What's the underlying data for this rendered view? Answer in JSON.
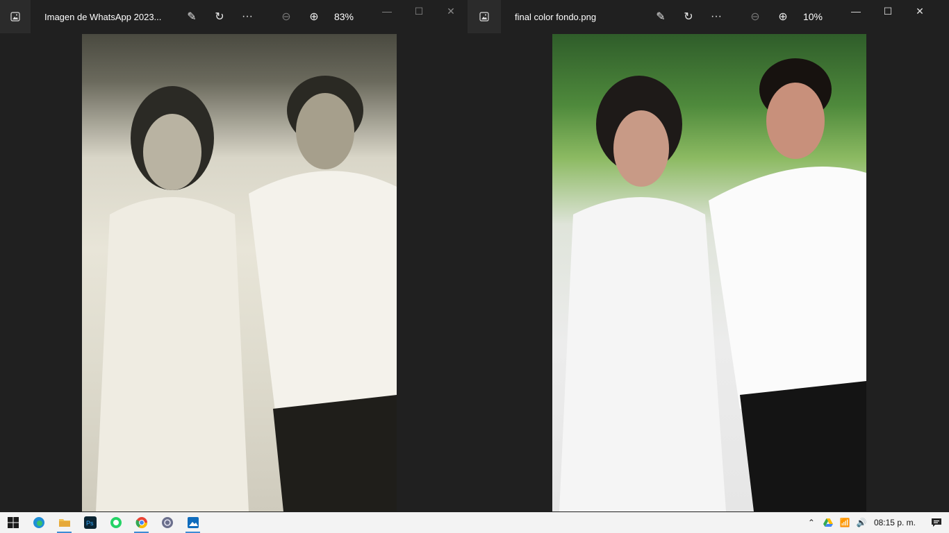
{
  "left_window": {
    "title": "Imagen de WhatsApp 2023...",
    "zoom": "83%",
    "icons": {
      "app": "photos-app-icon",
      "edit": "edit-image-icon",
      "rotate": "rotate-icon",
      "more": "more-icon",
      "zoom_out": "zoom-out-icon",
      "zoom_in": "zoom-in-icon"
    }
  },
  "right_window": {
    "title": "final color fondo.png",
    "zoom": "10%"
  },
  "taskbar": {
    "apps": [
      "start",
      "edge",
      "file-explorer",
      "photoshop",
      "whatsapp",
      "chrome",
      "browser",
      "photos"
    ],
    "clock": "08:15 p. m."
  },
  "colors": {
    "titlebar_bg": "#202020",
    "taskbar_bg": "#f3f3f3",
    "active_indicator": "#3d8bd5"
  }
}
